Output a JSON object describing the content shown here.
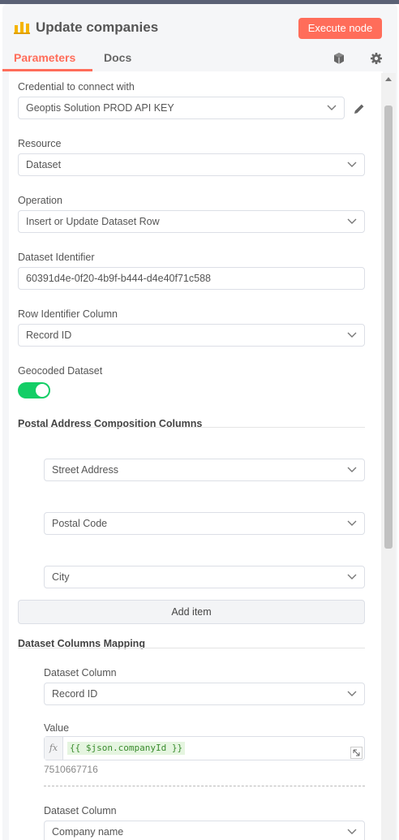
{
  "header": {
    "title": "Update companies",
    "execute_label": "Execute node",
    "tabs": [
      "Parameters",
      "Docs"
    ],
    "accent_color": "#ff6d5a"
  },
  "params": {
    "credential": {
      "label": "Credential to connect with",
      "value": "Geoptis Solution PROD API KEY"
    },
    "resource": {
      "label": "Resource",
      "value": "Dataset"
    },
    "operation": {
      "label": "Operation",
      "value": "Insert or Update Dataset Row"
    },
    "dataset_id": {
      "label": "Dataset Identifier",
      "value": "60391d4e-0f20-4b9f-b444-d4e40f71c588"
    },
    "row_id": {
      "label": "Row Identifier Column",
      "value": "Record ID"
    },
    "geocoded": {
      "label": "Geocoded Dataset",
      "on": true
    },
    "postal": {
      "title": "Postal Address Composition Columns",
      "items": [
        "Street Address",
        "Postal Code",
        "City"
      ],
      "add_label": "Add item"
    },
    "mapping": {
      "title": "Dataset Columns Mapping",
      "column_label": "Dataset Column",
      "value_label": "Value",
      "entries": [
        {
          "column": "Record ID",
          "expression": "{{ $json.companyId }}",
          "preview": "7510667716"
        },
        {
          "column": "Company name"
        }
      ]
    }
  }
}
